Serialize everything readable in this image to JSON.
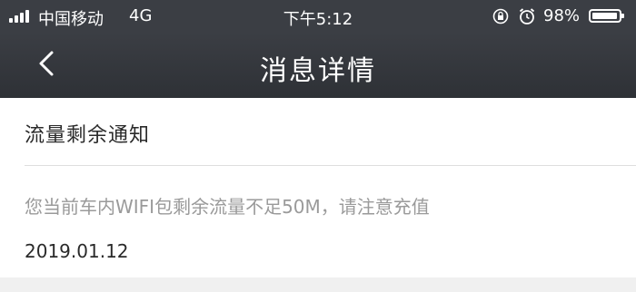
{
  "status_bar": {
    "carrier": "中国移动",
    "network": "4G",
    "time": "下午5:12",
    "battery_percent": "98%",
    "battery_level": 0.98,
    "icons": [
      "signal-icon",
      "orientation-lock-icon",
      "alarm-icon",
      "battery-icon"
    ]
  },
  "nav": {
    "back_icon": "chevron-left-icon",
    "title": "消息详情"
  },
  "message": {
    "title": "流量剩余通知",
    "body": "您当前车内WIFI包剩余流量不足50M，请注意充值",
    "date": "2019.01.12"
  },
  "colors": {
    "header_bg": "#3b3e44",
    "page_bg": "#ffffff",
    "body_text": "#9a9a9a",
    "title_text": "#2a2a2a"
  }
}
